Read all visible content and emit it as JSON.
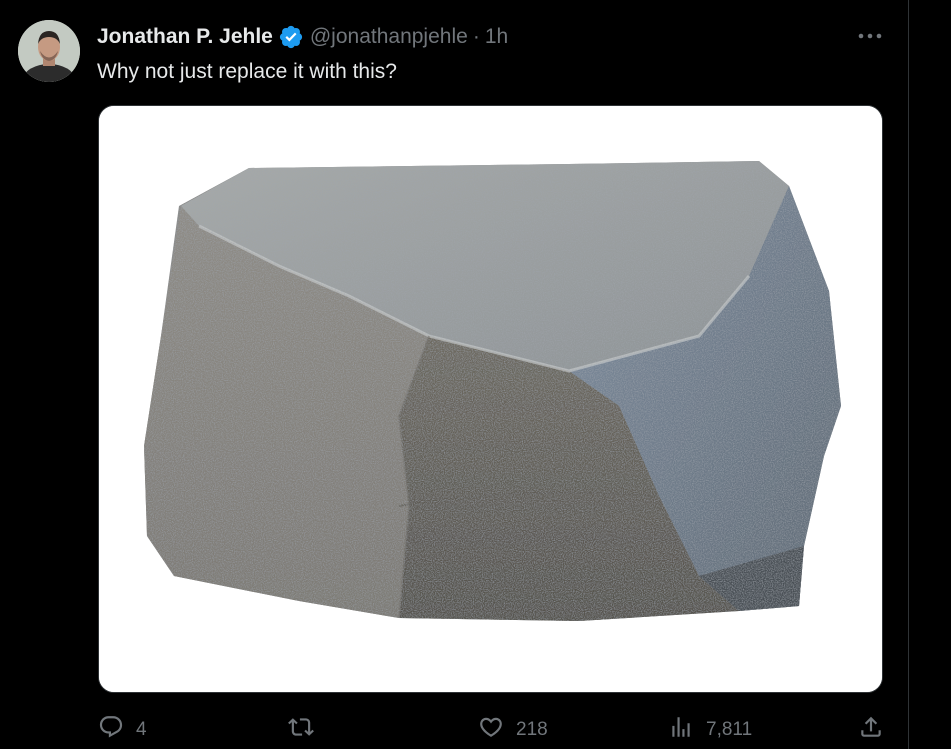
{
  "tweet": {
    "author_name": "Jonathan P. Jehle",
    "handle": "@jonathanpjehle",
    "separator": "·",
    "time": "1h",
    "text": "Why not just replace it with this?"
  },
  "icons": {
    "verified": "verified-badge-icon",
    "more": "more-options-icon",
    "reply": "reply-icon",
    "retweet": "retweet-icon",
    "like": "like-icon",
    "views": "views-icon",
    "share": "share-icon"
  },
  "actions": {
    "reply_count": "4",
    "retweet_count": "",
    "like_count": "218",
    "view_count": "7,811"
  },
  "colors": {
    "background": "#000000",
    "text_primary": "#e7e9ea",
    "text_secondary": "#71767b",
    "verified_blue": "#1d9bf0",
    "divider": "#2f3336"
  }
}
